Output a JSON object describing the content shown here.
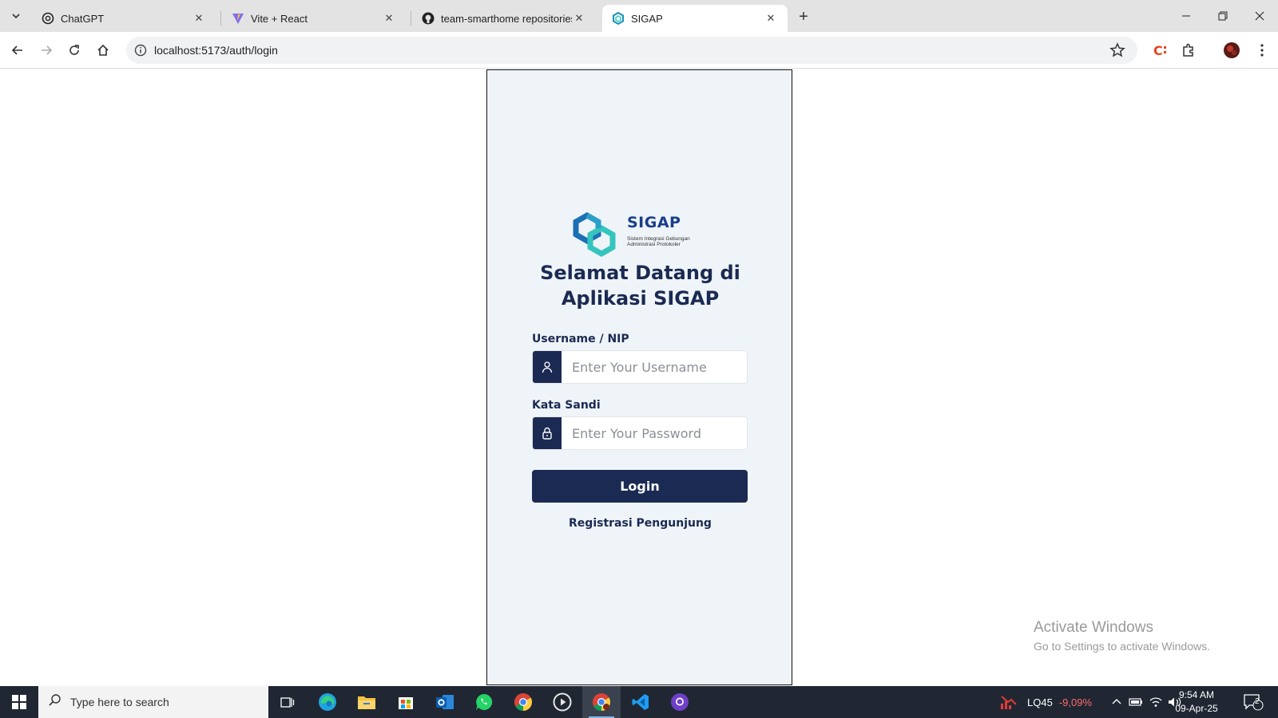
{
  "browser": {
    "tabs": [
      {
        "title": "ChatGPT",
        "favicon": "chatgpt-icon"
      },
      {
        "title": "Vite + React",
        "favicon": "vite-icon"
      },
      {
        "title": "team-smarthome repositories",
        "favicon": "github-icon"
      },
      {
        "title": "SIGAP",
        "favicon": "sigap-icon",
        "active": true
      }
    ],
    "url": "localhost:5173/auth/login"
  },
  "login": {
    "logo_word": "SIGAP",
    "logo_subtitle": "Sistem Integrasi Gebungan Administrasi Protokoler",
    "welcome_line1": "Selamat Datang di",
    "welcome_line2": "Aplikasi SIGAP",
    "username_label": "Username / NIP",
    "username_placeholder": "Enter Your Username",
    "password_label": "Kata Sandi",
    "password_placeholder": "Enter Your Password",
    "login_button": "Login",
    "register_link": "Registrasi Pengunjung"
  },
  "watermark": {
    "line1": "Activate Windows",
    "line2": "Go to Settings to activate Windows."
  },
  "taskbar": {
    "search_placeholder": "Type here to search",
    "stock_name": "LQ45",
    "stock_change": "-9,09%",
    "time": "9:54 AM",
    "date": "09-Apr-25",
    "notification_count": "2"
  },
  "colors": {
    "primary": "#1b2a52",
    "frame_bg": "#eff4f8",
    "stock_down": "#ff6b6b"
  }
}
